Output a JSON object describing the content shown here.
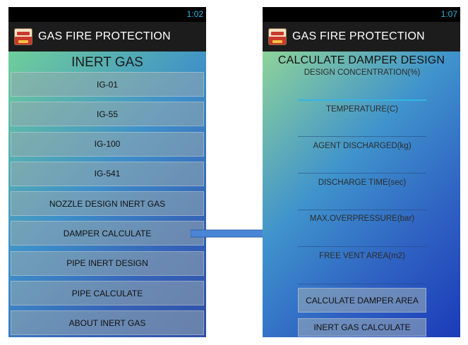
{
  "left_screen": {
    "status_time": "1:02",
    "app_title": "GAS FIRE PROTECTION",
    "screen_title": "INERT GAS",
    "menu_items": [
      "IG-01",
      "IG-55",
      "IG-100",
      "IG-541",
      "NOZZLE DESIGN INERT GAS",
      "DAMPER CALCULATE",
      "PIPE INERT DESIGN",
      "PIPE CALCULATE",
      "ABOUT INERT GAS"
    ]
  },
  "right_screen": {
    "status_time": "1:07",
    "app_title": "GAS FIRE PROTECTION",
    "screen_title": "CALCULATE DAMPER DESIGN",
    "fields": [
      {
        "label": "DESIGN CONCENTRATION(%)",
        "value": ""
      },
      {
        "label": "TEMPERATURE(C)",
        "value": ""
      },
      {
        "label": "AGENT DISCHARGED(kg)",
        "value": ""
      },
      {
        "label": "DISCHARGE TIME(sec)",
        "value": ""
      },
      {
        "label": "MAX.OVERPRESSURE(bar)",
        "value": ""
      },
      {
        "label": "FREE VENT AREA(m2)",
        "value": ""
      }
    ],
    "calculate_button": "CALCULATE DAMPER AREA",
    "secondary_button": "INERT GAS CALCULATE"
  },
  "colors": {
    "status_time": "#33b5e5",
    "arrow": "#4a86d6",
    "focused_field": "#33b5e5"
  },
  "icons": {
    "app_icon": "fire-extinguisher-icon",
    "arrow": "right-arrow-icon"
  }
}
